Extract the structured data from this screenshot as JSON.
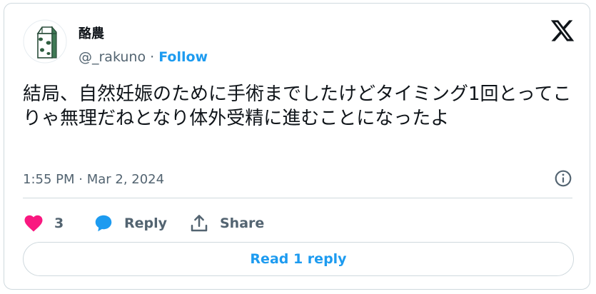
{
  "author": {
    "name": "酪農",
    "handle": "@_rakuno",
    "separator": " · ",
    "follow_label": "Follow"
  },
  "tweet": {
    "text": "結局、自然妊娠のために手術までしたけどタイミング1回とってこりゃ無理だねとなり体外受精に進むことになったよ",
    "timestamp": "1:55 PM · Mar 2, 2024"
  },
  "actions": {
    "like_count": "3",
    "reply_label": "Reply",
    "share_label": "Share"
  },
  "read_replies_label": "Read 1 reply",
  "icons": {
    "avatar": "milk-carton-avatar",
    "brand": "x-logo-icon",
    "info": "info-icon",
    "like": "heart-icon",
    "reply": "speech-bubble-icon",
    "share": "share-upload-icon"
  },
  "colors": {
    "accent": "#1d9bf0",
    "like": "#f91880",
    "text": "#0f1419",
    "muted": "#536471",
    "border": "#cfd9de"
  }
}
